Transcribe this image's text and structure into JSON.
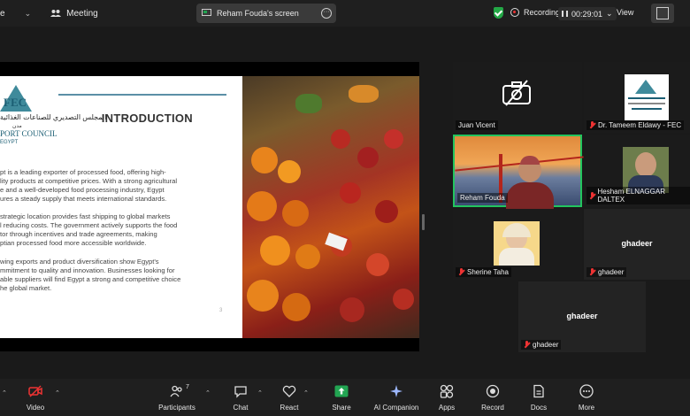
{
  "topbar": {
    "partial_left": "e",
    "meeting_label": "Meeting",
    "screen_tab": "Reham Fouda's screen",
    "recording_label": "Recording",
    "timer": "00:29:01",
    "view_label": "View",
    "colors": {
      "bg": "#1f1f1f",
      "shield": "#23a846",
      "recording_dot": "#e33333"
    }
  },
  "slide": {
    "title": "INTRODUCTION",
    "logo": {
      "abbr": "FEC",
      "arabic": "المجلس التصديري للصناعات الغذائية",
      "ar_small": "مدن",
      "line1": "PORT COUNCIL",
      "line2": "EGYPT"
    },
    "paragraphs": [
      [
        "pt is a leading exporter of processed food, offering high-",
        "lity products at competitive prices. With a strong agricultural",
        "e and a well-developed food processing industry, Egypt",
        "ures a steady supply that meets international standards."
      ],
      [
        "strategic location provides fast shipping to global markets",
        "l reducing costs. The government actively supports the food",
        "tor through incentives and trade agreements, making",
        "ptian processed food more accessible worldwide."
      ],
      [
        "wing exports and product diversification show Egypt's",
        "mmitment to quality and innovation. Businesses looking for",
        "able suppliers will find Egypt a strong and competitive choice",
        "he global market."
      ]
    ],
    "page_number": "3"
  },
  "participants": [
    {
      "name": "Juan Vicent",
      "muted": false,
      "camera": "off"
    },
    {
      "name": "Dr. Tameem Eldawy - FEC",
      "muted": true,
      "camera": "logo"
    },
    {
      "name": "Reham Fouda",
      "muted": false,
      "camera": "video",
      "active_speaker": true
    },
    {
      "name": "Hesham ELNAGGAR DALTEX",
      "muted": true,
      "camera": "photo"
    },
    {
      "name": "Sherine Taha",
      "muted": true,
      "camera": "photo"
    },
    {
      "name": "ghadeer",
      "muted": true,
      "camera": "off",
      "center_label": "ghadeer"
    },
    {
      "name": "ghadeer",
      "muted": true,
      "camera": "off",
      "center_label": "ghadeer"
    }
  ],
  "toolbar": {
    "items": [
      {
        "label": "Video",
        "icon": "video-off-icon"
      },
      {
        "label": "Participants",
        "icon": "participants-icon",
        "count": "7"
      },
      {
        "label": "Chat",
        "icon": "chat-icon"
      },
      {
        "label": "React",
        "icon": "heart-icon"
      },
      {
        "label": "Share",
        "icon": "share-icon"
      },
      {
        "label": "AI Companion",
        "icon": "ai-sparkle-icon"
      },
      {
        "label": "Apps",
        "icon": "apps-icon"
      },
      {
        "label": "Record",
        "icon": "record-icon"
      },
      {
        "label": "Docs",
        "icon": "docs-icon"
      },
      {
        "label": "More",
        "icon": "more-icon"
      }
    ],
    "share_color": "#22a552"
  }
}
